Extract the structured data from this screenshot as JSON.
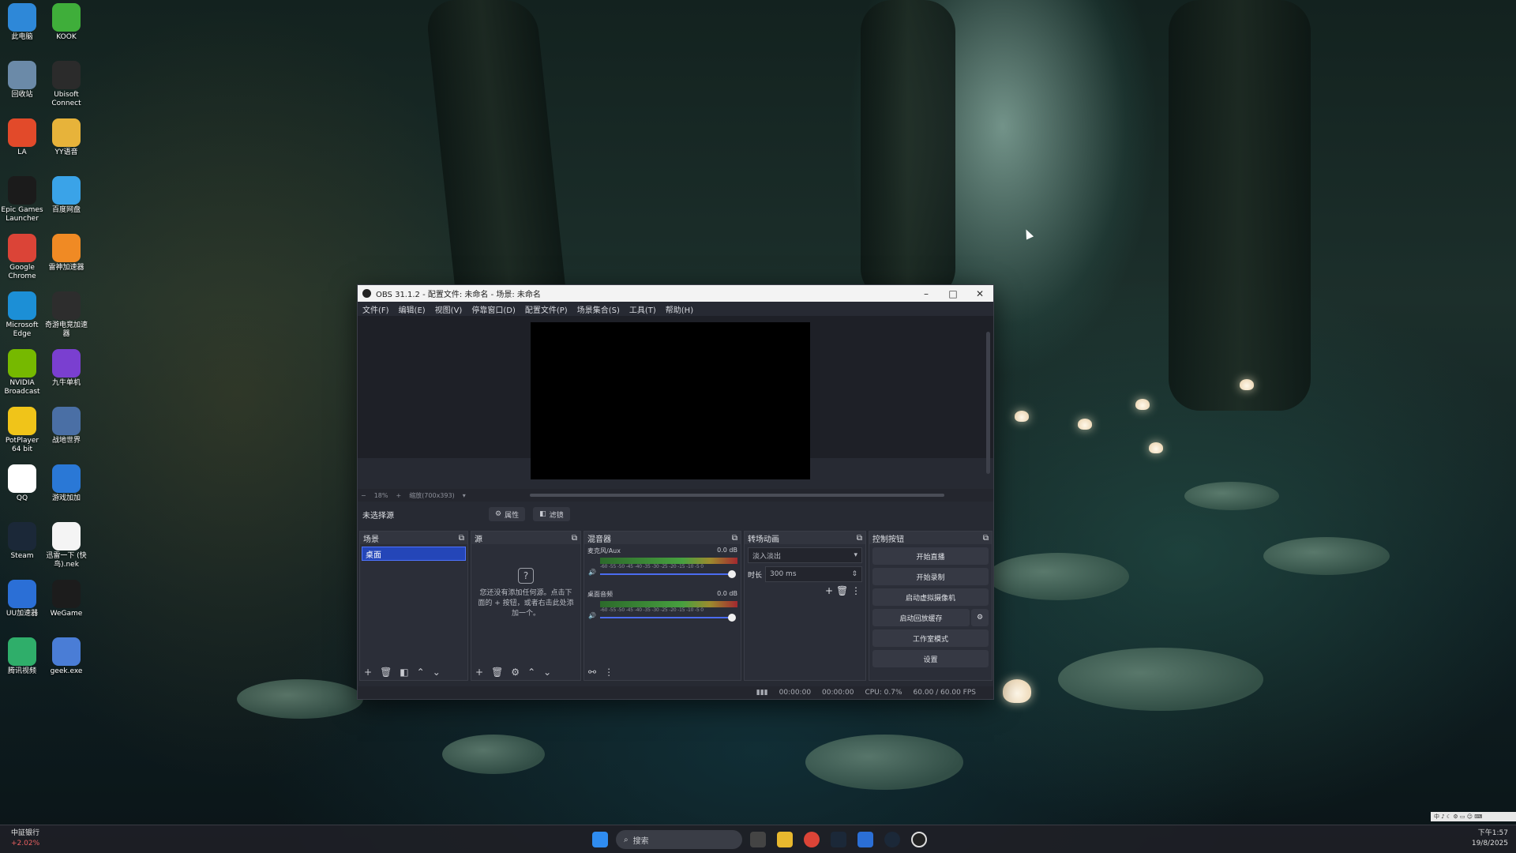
{
  "desktop": {
    "icons": [
      {
        "label": "此电脑",
        "color": "#2e88d8"
      },
      {
        "label": "KOOK",
        "color": "#3fae3a"
      },
      {
        "label": "回收站",
        "color": "#6b8aa8"
      },
      {
        "label": "Ubisoft Connect",
        "color": "#2b2b2b"
      },
      {
        "label": "LA",
        "color": "#e24a2a"
      },
      {
        "label": "YY语音",
        "color": "#e7b33a"
      },
      {
        "label": "Epic Games Launcher",
        "color": "#1b1b1b"
      },
      {
        "label": "百度网盘",
        "color": "#3aa3e8"
      },
      {
        "label": "Google Chrome",
        "color": "#db4437"
      },
      {
        "label": "雷神加速器",
        "color": "#f08a24"
      },
      {
        "label": "Microsoft Edge",
        "color": "#1c8fd6"
      },
      {
        "label": "奇游电竞加速器",
        "color": "#2d2d2d"
      },
      {
        "label": "NVIDIA Broadcast",
        "color": "#76b900"
      },
      {
        "label": "九牛单机",
        "color": "#7a3fd0"
      },
      {
        "label": "PotPlayer 64 bit",
        "color": "#f0c419"
      },
      {
        "label": "战地世界",
        "color": "#4a6fa5"
      },
      {
        "label": "QQ",
        "color": "#ffffff"
      },
      {
        "label": "游戏加加",
        "color": "#2a78d6"
      },
      {
        "label": "Steam",
        "color": "#1b2838"
      },
      {
        "label": "迅雷一下 (快鸟).nek",
        "color": "#f4f4f4"
      },
      {
        "label": "UU加速器",
        "color": "#2b6fd6"
      },
      {
        "label": "WeGame",
        "color": "#1c1c1c"
      },
      {
        "label": "腾讯视频",
        "color": "#2fae6a"
      },
      {
        "label": "geek.exe",
        "color": "#4a7dd6"
      }
    ]
  },
  "obs": {
    "title": "OBS 31.1.2 - 配置文件: 未命名 - 场景: 未命名",
    "menu": [
      "文件(F)",
      "编辑(E)",
      "视图(V)",
      "停靠窗口(D)",
      "配置文件(P)",
      "场景集合(S)",
      "工具(T)",
      "帮助(H)"
    ],
    "zoom": {
      "minus": "−",
      "percent": "18%",
      "plus": "+",
      "fit": "缩放(700x393)"
    },
    "scene_label": "未选择源",
    "props_btn": "属性",
    "filters_btn": "滤镜",
    "docks": {
      "scenes": {
        "title": "场景",
        "items": [
          "桌面"
        ]
      },
      "sources": {
        "title": "源",
        "empty_text": "您还没有添加任何源。点击下面的 + 按钮，或者右击此处添加一个。"
      },
      "mixer": {
        "title": "混音器",
        "channels": [
          {
            "name": "麦克风/Aux",
            "db": "0.0 dB"
          },
          {
            "name": "桌面音频",
            "db": "0.0 dB"
          }
        ],
        "scale": "-60 -55 -50 -45 -40 -35 -30 -25 -20 -15 -10 -5 0"
      },
      "transitions": {
        "title": "转场动画",
        "type": "淡入淡出",
        "duration_label": "时长",
        "duration": "300 ms"
      },
      "controls": {
        "title": "控制按钮",
        "buttons": [
          "开始直播",
          "开始录制",
          "启动虚拟摄像机",
          "启动回放缓存",
          "工作室模式",
          "设置"
        ]
      }
    },
    "status": {
      "stream_time": "00:00:00",
      "rec_time": "00:00:00",
      "cpu": "CPU: 0.7%",
      "fps": "60.00 / 60.00 FPS"
    }
  },
  "taskbar": {
    "stock_name": "中証银行",
    "stock_change": "+2.02%",
    "search_placeholder": "搜索",
    "time": "下午1:57",
    "date": "19/8/2025"
  }
}
